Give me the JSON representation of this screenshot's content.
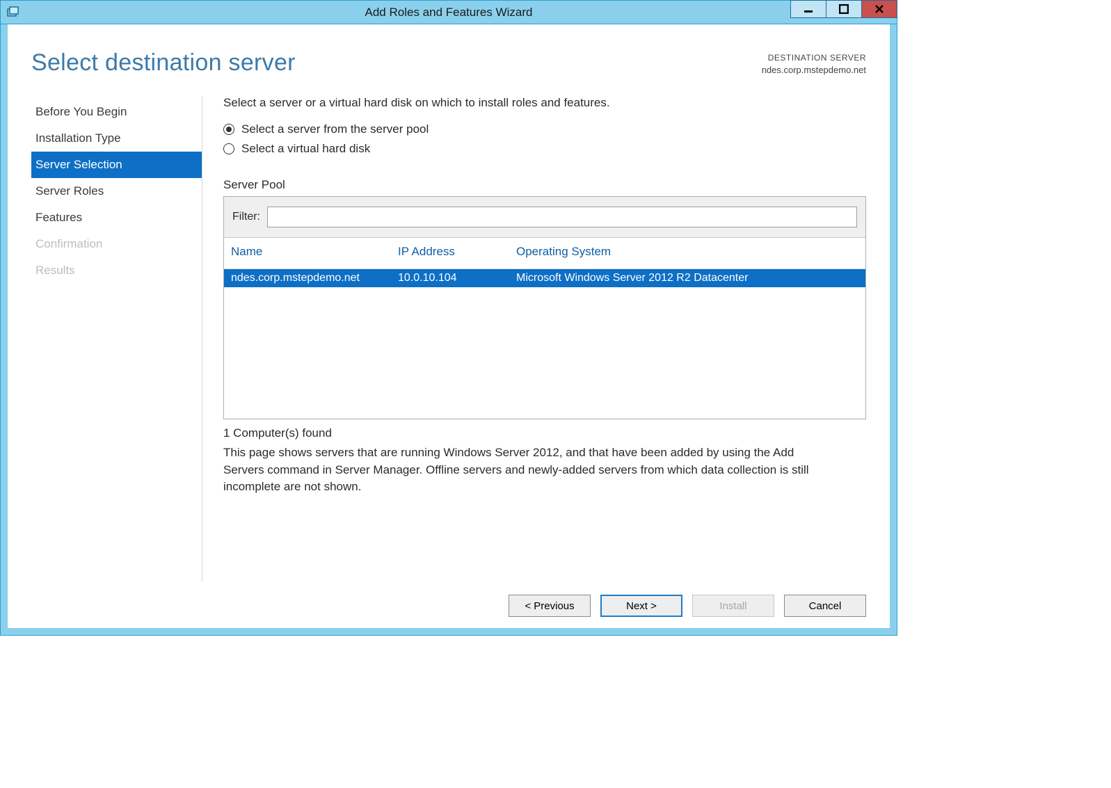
{
  "window": {
    "title": "Add Roles and Features Wizard"
  },
  "header": {
    "page_title": "Select destination server",
    "destination_label": "DESTINATION SERVER",
    "destination_value": "ndes.corp.mstepdemo.net"
  },
  "steps": [
    {
      "label": "Before You Begin",
      "state": "normal"
    },
    {
      "label": "Installation Type",
      "state": "normal"
    },
    {
      "label": "Server Selection",
      "state": "active"
    },
    {
      "label": "Server Roles",
      "state": "normal"
    },
    {
      "label": "Features",
      "state": "normal"
    },
    {
      "label": "Confirmation",
      "state": "disabled"
    },
    {
      "label": "Results",
      "state": "disabled"
    }
  ],
  "main": {
    "instruction": "Select a server or a virtual hard disk on which to install roles and features.",
    "radio_pool": "Select a server from the server pool",
    "radio_vhd": "Select a virtual hard disk",
    "section_label": "Server Pool",
    "filter_label": "Filter:",
    "filter_value": "",
    "columns": {
      "name": "Name",
      "ip": "IP Address",
      "os": "Operating System"
    },
    "rows": [
      {
        "name": "ndes.corp.mstepdemo.net",
        "ip": "10.0.10.104",
        "os": "Microsoft Windows Server 2012 R2 Datacenter",
        "selected": true
      }
    ],
    "found_count": "1 Computer(s) found",
    "explain": "This page shows servers that are running Windows Server 2012, and that have been added by using the Add Servers command in Server Manager. Offline servers and newly-added servers from which data collection is still incomplete are not shown."
  },
  "footer": {
    "previous": "< Previous",
    "next": "Next >",
    "install": "Install",
    "cancel": "Cancel"
  }
}
